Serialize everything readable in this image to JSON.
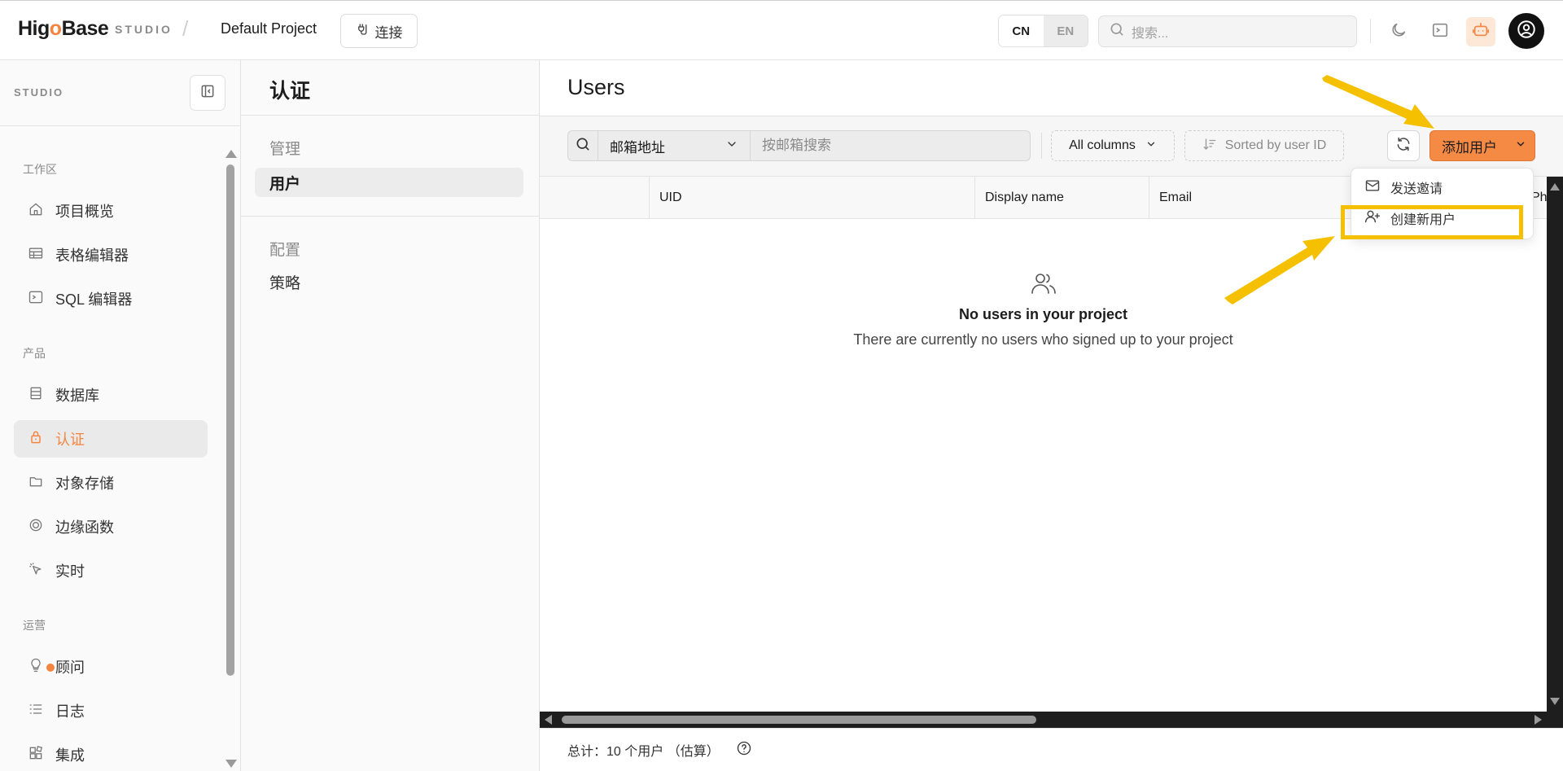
{
  "topbar": {
    "logo_prefix": "Hi",
    "logo_g": "g",
    "logo_o": "o",
    "logo_suffix": "Base",
    "studio_tag": "STUDIO",
    "separator": "/",
    "project_name": "Default Project",
    "connect_label": "连接",
    "lang_cn": "CN",
    "lang_en": "EN",
    "search_placeholder": "搜索..."
  },
  "sidebar": {
    "studio_label": "STUDIO",
    "sections": {
      "workspace": "工作区",
      "product": "产品",
      "operations": "运营"
    },
    "items": {
      "overview": "项目概览",
      "table_editor": "表格编辑器",
      "sql_editor": "SQL 编辑器",
      "database": "数据库",
      "auth": "认证",
      "storage": "对象存储",
      "edge_functions": "边缘函数",
      "realtime": "实时",
      "advisor": "顾问",
      "logs": "日志",
      "integrations": "集成"
    },
    "active_item": "auth"
  },
  "submenu": {
    "title": "认证",
    "manage_section": "管理",
    "users_item": "用户",
    "config_section": "配置",
    "policies_item": "策略"
  },
  "main": {
    "title": "Users",
    "toolbar": {
      "filter_field": "邮箱地址",
      "search_placeholder": "按邮箱搜索",
      "columns_label": "All columns",
      "sort_label": "Sorted by user ID",
      "add_user_label": "添加用户"
    },
    "columns": [
      "UID",
      "Display name",
      "Email",
      "Phone"
    ],
    "empty_state": {
      "title": "No users in your project",
      "subtitle": "There are currently no users who signed up to your project"
    },
    "footer": {
      "total_text": "总计：10 个用户 （估算）"
    }
  },
  "dropdown": {
    "send_invite": "发送邀请",
    "create_user": "创建新用户"
  },
  "colors": {
    "accent": "#f58a45",
    "annotation": "#f5c000"
  }
}
